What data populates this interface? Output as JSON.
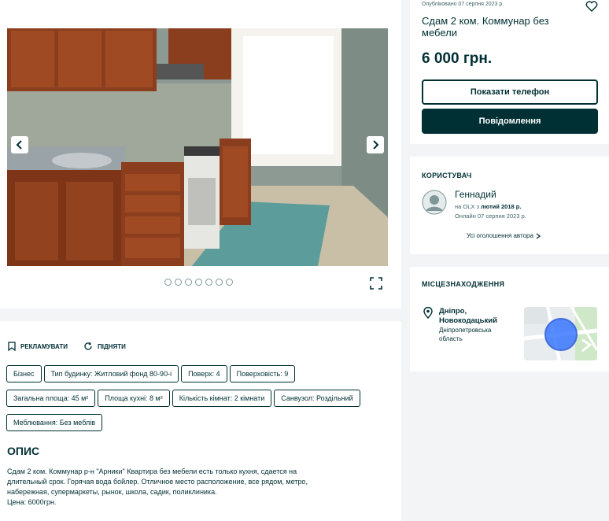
{
  "listing": {
    "published": "Опубліковано 07 серпня 2023 р.",
    "title": "Сдам 2 ком. Коммунар без мебели",
    "price": "6 000 грн.",
    "show_phone": "Показати телефон",
    "message": "Повідомлення"
  },
  "gallery": {
    "dot_count": 7
  },
  "actions": {
    "promote": "РЕКЛАМУВАТИ",
    "raise": "ПІДНЯТИ"
  },
  "tags": [
    "Бізнес",
    "Тип будинку: Житловий фонд 80-90-і",
    "Поверх: 4",
    "Поверховість: 9",
    "Загальна площа: 45 м²",
    "Площа кухні: 8 м²",
    "Кількість кімнат: 2 кімнати",
    "Санвузол: Роздільний",
    "Меблювання: Без меблів"
  ],
  "description": {
    "heading": "ОПИС",
    "line1": "Сдам 2 ком. Коммунар р-н \"Арники\" Квартира без мебели есть только кухня, сдается на",
    "line2": "длительный срок. Горячая вода бойлер. Отличное место расположение, все рядом, метро,",
    "line3": "набережная, супермаркеты, рынок, школа, садик, поликлиника.",
    "line4": "Цена: 6000грн."
  },
  "user": {
    "section_title": "КОРИСТУВАЧ",
    "name": "Геннадий",
    "since_prefix": "на OLX з ",
    "since_date": "лютий 2018 р.",
    "online": "Онлайн 07 серпня 2023 р.",
    "all_ads": "Усі оголошення автора"
  },
  "location": {
    "section_title": "МІСЦЕЗНАХОДЖЕННЯ",
    "city": "Дніпро,",
    "district": "Новокодацький",
    "region": "Дніпропетровська",
    "region2": "область"
  },
  "colors": {
    "accent": "#002f34",
    "page_bg": "#f2f4f5",
    "map_pin": "#3a77ff"
  }
}
